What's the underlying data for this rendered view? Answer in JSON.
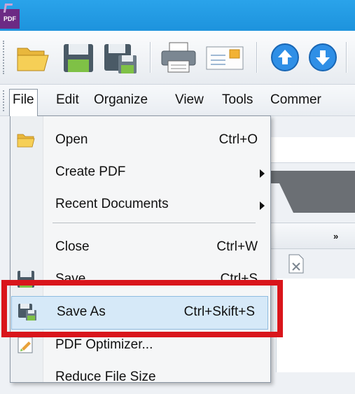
{
  "app": {
    "icon_text": "PDF"
  },
  "toolbar": {
    "buttons": [
      {
        "name": "open-folder-icon"
      },
      {
        "name": "save-icon"
      },
      {
        "name": "save-as-icon"
      },
      {
        "name": "print-icon"
      },
      {
        "name": "email-icon"
      },
      {
        "name": "arrow-up-icon"
      },
      {
        "name": "arrow-down-icon"
      }
    ]
  },
  "menubar": {
    "items": [
      "File",
      "Edit",
      "Organize",
      "View",
      "Tools",
      "Commer"
    ]
  },
  "file_menu": {
    "items": [
      {
        "label": "Open",
        "shortcut": "Ctrl+O",
        "icon": "open-folder-icon"
      },
      {
        "label": "Create PDF",
        "submenu": true
      },
      {
        "label": "Recent Documents",
        "submenu": true
      },
      {
        "label": "Close",
        "shortcut": "Ctrl+W"
      },
      {
        "label": "Save",
        "shortcut": "Ctrl+S",
        "icon": "save-icon"
      },
      {
        "label": "Save As",
        "shortcut": "Ctrl+Skift+S",
        "icon": "save-as-icon",
        "highlighted": true
      },
      {
        "label": "PDF Optimizer...",
        "icon": "optimizer-icon"
      },
      {
        "label": "Reduce File Size"
      }
    ]
  },
  "colors": {
    "titlebar": "#1d93dd",
    "highlight_box": "#d9151b",
    "hover_bg": "#d6e9f8"
  }
}
